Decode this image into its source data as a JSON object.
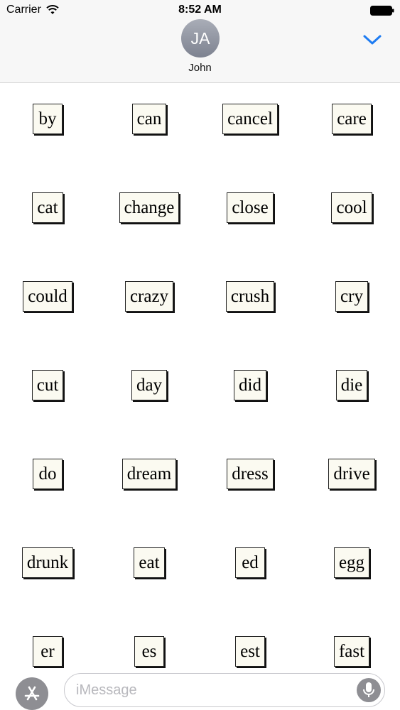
{
  "status_bar": {
    "carrier": "Carrier",
    "time": "8:52 AM"
  },
  "header": {
    "avatar_initials": "JA",
    "contact_name": "John",
    "accent_color": "#1e7cf2"
  },
  "stickers": [
    [
      "by",
      "can",
      "cancel",
      "care"
    ],
    [
      "cat",
      "change",
      "close",
      "cool"
    ],
    [
      "could",
      "crazy",
      "crush",
      "cry"
    ],
    [
      "cut",
      "day",
      "did",
      "die"
    ],
    [
      "do",
      "dream",
      "dress",
      "drive"
    ],
    [
      "drunk",
      "eat",
      "ed",
      "egg"
    ],
    [
      "er",
      "es",
      "est",
      "fast"
    ]
  ],
  "compose": {
    "placeholder": "iMessage",
    "apps_icon": "app-store-icon",
    "mic_icon": "microphone-icon"
  }
}
